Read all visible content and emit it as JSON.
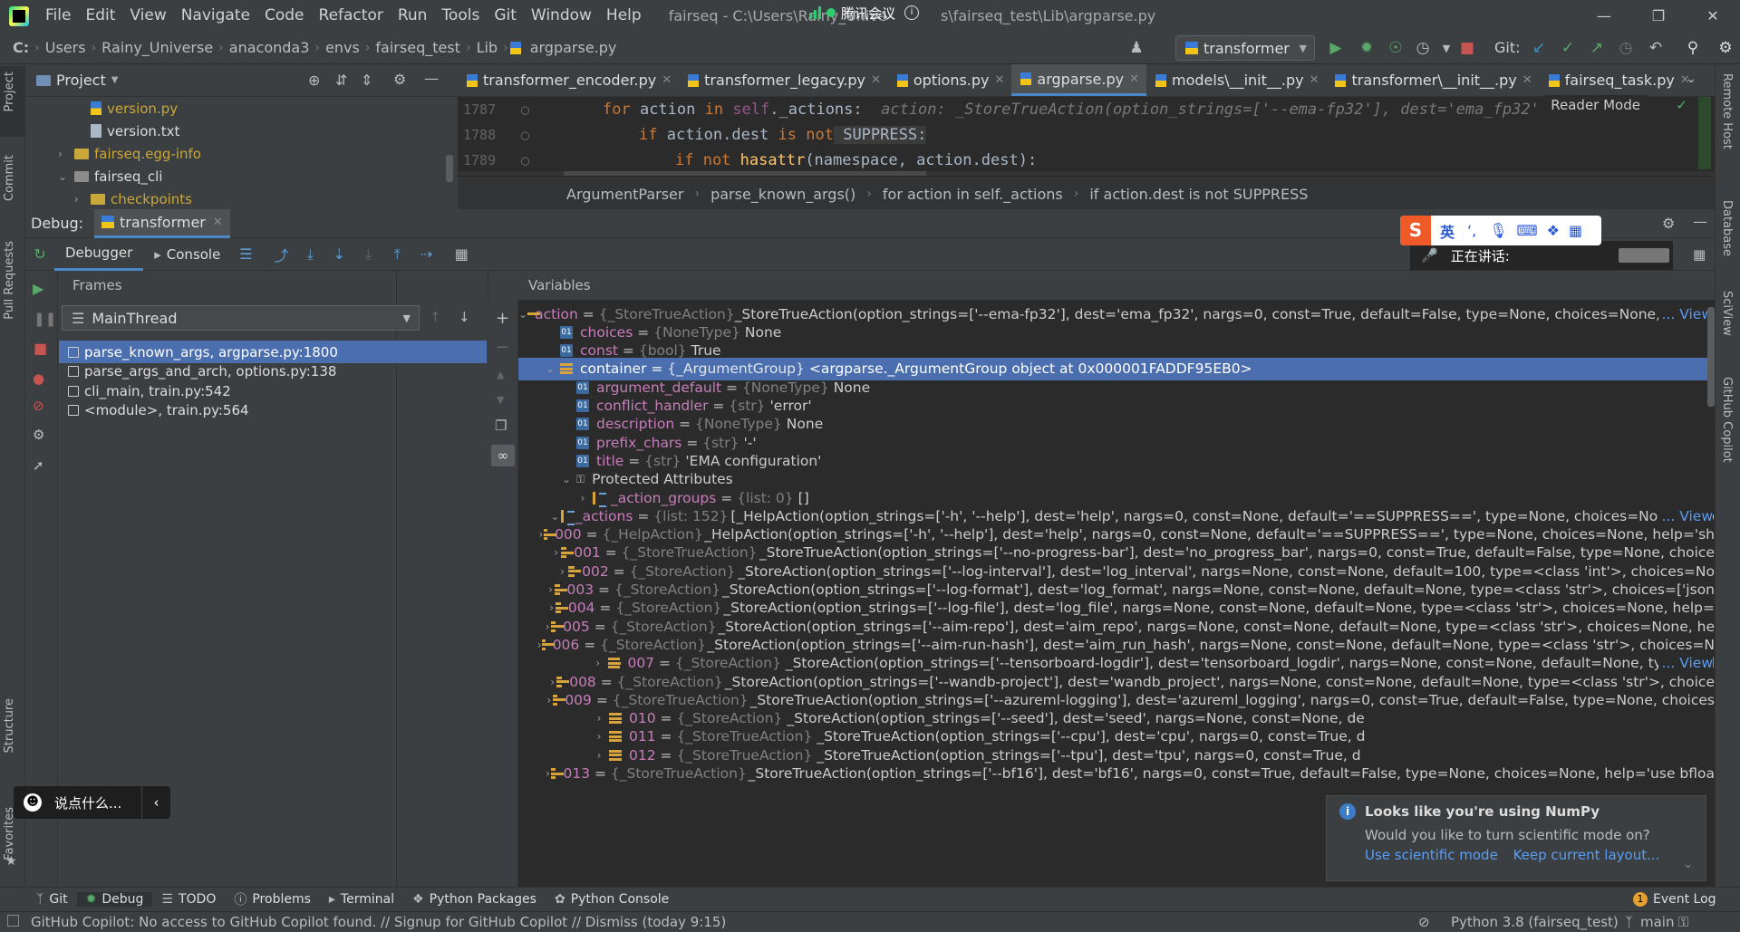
{
  "window": {
    "menu": [
      "File",
      "Edit",
      "View",
      "Navigate",
      "Code",
      "Refactor",
      "Run",
      "Tools",
      "Git",
      "Window",
      "Help"
    ],
    "title": "fairseq - C:\\Users\\Rainy_Unive",
    "title_tail": "s\\fairseq_test\\Lib\\argparse.py",
    "meeting_label": "腾讯会议"
  },
  "nav": {
    "crumbs": [
      "C:",
      "Users",
      "Rainy_Universe",
      "anaconda3",
      "envs",
      "fairseq_test",
      "Lib",
      "argparse.py"
    ],
    "run_config": "transformer",
    "git_label": "Git:"
  },
  "left_stripe": [
    "Project",
    "Commit",
    "Pull Requests",
    "Structure",
    "Favorites"
  ],
  "right_stripe": [
    "Remote Host",
    "Database",
    "SciView",
    "GitHub Copilot"
  ],
  "project": {
    "title": "Project",
    "rows": [
      {
        "label": "version.py",
        "indent": 2,
        "kind": "py-y"
      },
      {
        "label": "version.txt",
        "indent": 2,
        "kind": "txt"
      },
      {
        "label": "fairseq.egg-info",
        "indent": 1,
        "kind": "folder-y",
        "chev": "›"
      },
      {
        "label": "fairseq_cli",
        "indent": 1,
        "kind": "folder",
        "chev": "⌄"
      },
      {
        "label": "checkpoints",
        "indent": 2,
        "kind": "folder-y",
        "chev": "›"
      }
    ]
  },
  "editor": {
    "tabs": [
      "transformer_encoder.py",
      "transformer_legacy.py",
      "options.py",
      "argparse.py",
      "models\\__init__.py",
      "transformer\\__init__.py",
      "fairseq_task.py"
    ],
    "active_tab": "argparse.py",
    "reader_mode": "Reader Mode",
    "lines": [
      {
        "num": "1787",
        "code_kw": "for",
        "code_mid": " action ",
        "code_kw2": "in",
        "code_self": " self",
        "code_rest": "._actions:",
        "hint": "  action: _StoreTrueAction(option_strings=['--ema-fp32'], dest='ema_fp32'"
      },
      {
        "num": "1788",
        "indent": "    ",
        "code_kw": "if",
        "code_rest": " action.dest ",
        "code_kw2": "is not",
        "code_sup": " SUPPRESS:"
      },
      {
        "num": "1789",
        "indent": "        ",
        "code_kw": "if not",
        "code_fn": " hasattr",
        "code_rest": "(namespace, action.dest):"
      }
    ],
    "breadcrumb": [
      "ArgumentParser",
      "parse_known_args()",
      "for action in self._actions",
      "if action.dest is not SUPPRESS"
    ]
  },
  "debug": {
    "label": "Debug:",
    "config": "transformer",
    "tabs": [
      "Debugger",
      "Console"
    ],
    "frames_title": "Frames",
    "thread": "MainThread",
    "frames": [
      "parse_known_args, argparse.py:1800",
      "parse_args_and_arch, options.py:138",
      "cli_main, train.py:542",
      "<module>, train.py:564"
    ],
    "variables_title": "Variables",
    "variables": [
      {
        "depth": 0,
        "chev": "⌄",
        "icon": "list",
        "name": "action",
        "type": "{_StoreTrueAction}",
        "value": "_StoreTrueAction(option_strings=['--ema-fp32'], dest='ema_fp32', nargs=0, const=True, default=False, type=None, choices=None, help='l",
        "view": "... View"
      },
      {
        "depth": 1,
        "icon": "01",
        "name": "choices",
        "type": "{NoneType}",
        "value": "None"
      },
      {
        "depth": 1,
        "icon": "01",
        "name": "const",
        "type": "{bool}",
        "value": "True"
      },
      {
        "depth": 1,
        "chev": "⌄",
        "icon": "list",
        "name": "container",
        "type": "{_ArgumentGroup}",
        "value": "<argparse._ArgumentGroup object at 0x000001FADDF95EB0>",
        "selected": true
      },
      {
        "depth": 2,
        "icon": "01",
        "name": "argument_default",
        "type": "{NoneType}",
        "value": "None"
      },
      {
        "depth": 2,
        "icon": "01",
        "name": "conflict_handler",
        "type": "{str}",
        "value": "'error'"
      },
      {
        "depth": 2,
        "icon": "01",
        "name": "description",
        "type": "{NoneType}",
        "value": "None"
      },
      {
        "depth": 2,
        "icon": "01",
        "name": "prefix_chars",
        "type": "{str}",
        "value": "'-'"
      },
      {
        "depth": 2,
        "icon": "01",
        "name": "title",
        "type": "{str}",
        "value": "'EMA configuration'"
      },
      {
        "depth": 2,
        "chev": "⌄",
        "icon": "key",
        "name": "",
        "type": "",
        "value": "Protected Attributes",
        "plain": true
      },
      {
        "depth": 3,
        "chev": "›",
        "icon": "vlist",
        "name": "_action_groups",
        "type": "{list: 0}",
        "value": "[]"
      },
      {
        "depth": 3,
        "chev": "⌄",
        "icon": "vlist",
        "name": "_actions",
        "type": "{list: 152}",
        "value": "[_HelpAction(option_strings=['-h', '--help'], dest='help', nargs=0, const=None, default='==SUPPRESS==', type=None, choices=None, help",
        "view": "... View"
      },
      {
        "depth": 4,
        "chev": "›",
        "icon": "list",
        "name": "000",
        "type": "{_HelpAction}",
        "value": "_HelpAction(option_strings=['-h', '--help'], dest='help', nargs=0, const=None, default='==SUPPRESS==', type=None, choices=None, help='sh"
      },
      {
        "depth": 4,
        "chev": "›",
        "icon": "list",
        "name": "001",
        "type": "{_StoreTrueAction}",
        "value": "_StoreTrueAction(option_strings=['--no-progress-bar'], dest='no_progress_bar', nargs=0, const=True, default=False, type=None, choice"
      },
      {
        "depth": 4,
        "chev": "›",
        "icon": "list",
        "name": "002",
        "type": "{_StoreAction}",
        "value": "_StoreAction(option_strings=['--log-interval'], dest='log_interval', nargs=None, const=None, default=100, type=<class 'int'>, choices=No"
      },
      {
        "depth": 4,
        "chev": "›",
        "icon": "list",
        "name": "003",
        "type": "{_StoreAction}",
        "value": "_StoreAction(option_strings=['--log-format'], dest='log_format', nargs=None, const=None, default=None, type=<class 'str'>, choices=['json"
      },
      {
        "depth": 4,
        "chev": "›",
        "icon": "list",
        "name": "004",
        "type": "{_StoreAction}",
        "value": "_StoreAction(option_strings=['--log-file'], dest='log_file', nargs=None, const=None, default=None, type=<class 'str'>, choices=None, help="
      },
      {
        "depth": 4,
        "chev": "›",
        "icon": "list",
        "name": "005",
        "type": "{_StoreAction}",
        "value": "_StoreAction(option_strings=['--aim-repo'], dest='aim_repo', nargs=None, const=None, default=None, type=<class 'str'>, choices=None, he"
      },
      {
        "depth": 4,
        "chev": "›",
        "icon": "list",
        "name": "006",
        "type": "{_StoreAction}",
        "value": "_StoreAction(option_strings=['--aim-run-hash'], dest='aim_run_hash', nargs=None, const=None, default=None, type=<class 'str'>, choices=N"
      },
      {
        "depth": 4,
        "chev": "›",
        "icon": "list",
        "name": "007",
        "type": "{_StoreAction}",
        "value": "_StoreAction(option_strings=['--tensorboard-logdir'], dest='tensorboard_logdir', nargs=None, const=None, default=None, type=<cl",
        "view": "... View"
      },
      {
        "depth": 4,
        "chev": "›",
        "icon": "list",
        "name": "008",
        "type": "{_StoreAction}",
        "value": "_StoreAction(option_strings=['--wandb-project'], dest='wandb_project', nargs=None, const=None, default=None, type=<class 'str'>, choice"
      },
      {
        "depth": 4,
        "chev": "›",
        "icon": "list",
        "name": "009",
        "type": "{_StoreTrueAction}",
        "value": "_StoreTrueAction(option_strings=['--azureml-logging'], dest='azureml_logging', nargs=0, const=True, default=False, type=None, choices"
      },
      {
        "depth": 4,
        "chev": "›",
        "icon": "list",
        "name": "010",
        "type": "{_StoreAction}",
        "value": "_StoreAction(option_strings=['--seed'], dest='seed', nargs=None, const=None, de"
      },
      {
        "depth": 4,
        "chev": "›",
        "icon": "list",
        "name": "011",
        "type": "{_StoreTrueAction}",
        "value": "_StoreTrueAction(option_strings=['--cpu'], dest='cpu', nargs=0, const=True, d"
      },
      {
        "depth": 4,
        "chev": "›",
        "icon": "list",
        "name": "012",
        "type": "{_StoreTrueAction}",
        "value": "_StoreTrueAction(option_strings=['--tpu'], dest='tpu', nargs=0, const=True, d"
      },
      {
        "depth": 4,
        "chev": "›",
        "icon": "list",
        "name": "013",
        "type": "{_StoreTrueAction}",
        "value": "_StoreTrueAction(option_strings=['--bf16'], dest='bf16', nargs=0, const=True, default=False, type=None, choices=None, help='use bfloa"
      }
    ]
  },
  "bottom_tabs": [
    "Git",
    "Debug",
    "TODO",
    "Problems",
    "Terminal",
    "Python Packages",
    "Python Console"
  ],
  "event_log": "Event Log",
  "event_count": "1",
  "status": {
    "message": "GitHub Copilot: No access to GitHub Copilot found. // Signup for GitHub Copilot // Dismiss (today 9:15)",
    "interpreter": "Python 3.8 (fairseq_test)",
    "branch": "main"
  },
  "numpy_popup": {
    "title": "Looks like you're using NumPy",
    "body": "Would you like to turn scientific mode on?",
    "link1": "Use scientific mode",
    "link2": "Keep current layout..."
  },
  "chat": {
    "placeholder": "说点什么..."
  },
  "ime": {
    "lang": "英"
  },
  "speaking": {
    "label": "正在讲话:"
  },
  "colors": {
    "accent": "#4a88c7",
    "selection": "#4b6eaf",
    "var_name": "#c77dbb",
    "link": "#589df6"
  }
}
